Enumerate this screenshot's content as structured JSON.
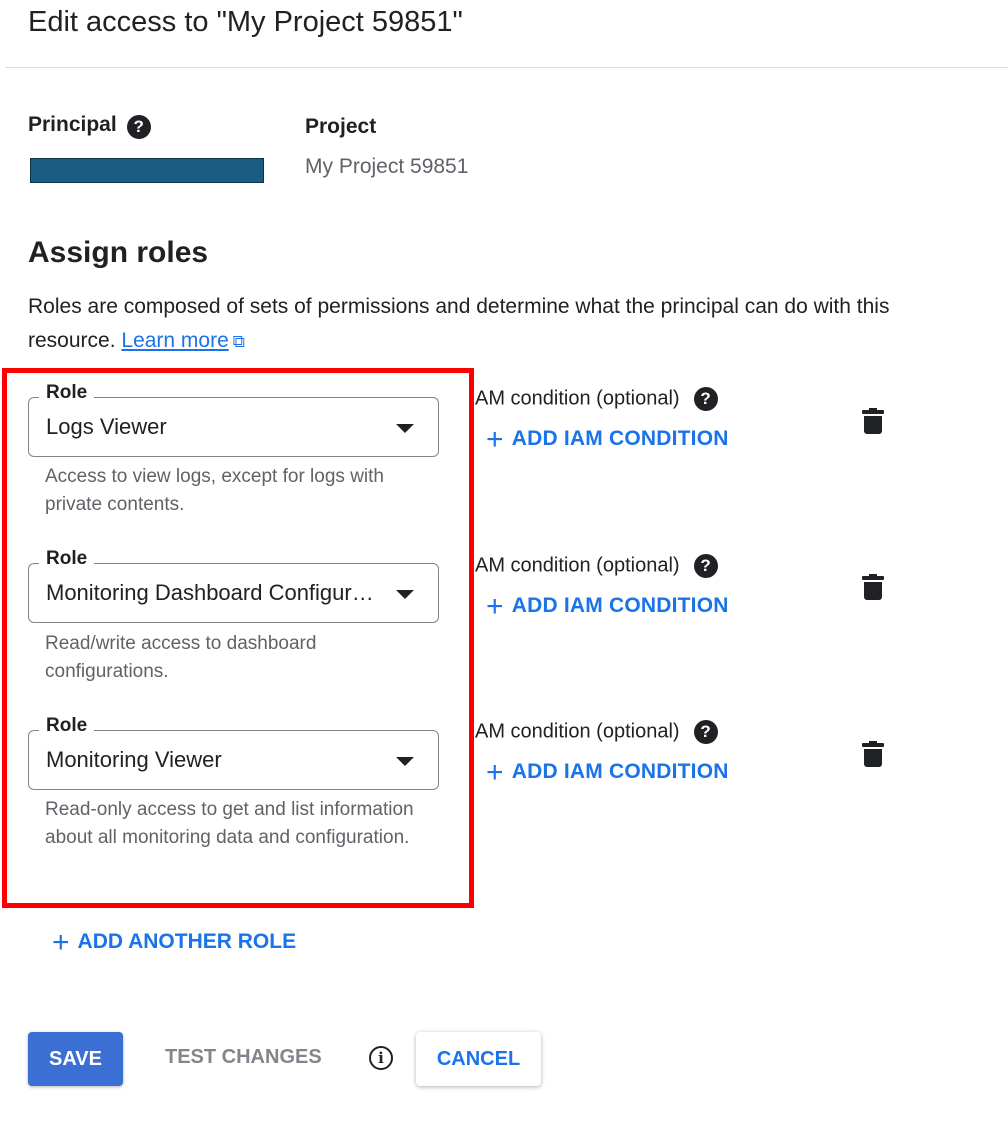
{
  "dialog": {
    "title": "Edit access to \"My Project 59851\""
  },
  "principal": {
    "label": "Principal",
    "help_icon": "?"
  },
  "project": {
    "label": "Project",
    "value": "My Project 59851"
  },
  "assign_roles": {
    "heading": "Assign roles",
    "description": "Roles are composed of sets of permissions and determine what the principal can do with this resource.",
    "learn_more": "Learn more",
    "external_icon": "⧉"
  },
  "roles": [
    {
      "legend": "Role",
      "value": "Logs Viewer",
      "description": "Access to view logs, except for logs with private contents.",
      "condition_label": "AM condition (optional)",
      "add_condition": "ADD IAM CONDITION"
    },
    {
      "legend": "Role",
      "value": "Monitoring Dashboard Configuration Editor",
      "description": "Read/write access to dashboard configurations.",
      "condition_label": "AM condition (optional)",
      "add_condition": "ADD IAM CONDITION"
    },
    {
      "legend": "Role",
      "value": "Monitoring Viewer",
      "description": "Read-only access to get and list information about all monitoring data and configuration.",
      "condition_label": "AM condition (optional)",
      "add_condition": "ADD IAM CONDITION"
    }
  ],
  "add_another_role": "ADD ANOTHER ROLE",
  "plus_glyph": "+",
  "info_glyph": "i",
  "buttons": {
    "save": "SAVE",
    "test": "TEST CHANGES",
    "cancel": "CANCEL"
  },
  "colors": {
    "accent": "#1a73e8",
    "save": "#3b6fd4",
    "highlight": "#ff0000",
    "redaction": "#1b5c82"
  }
}
